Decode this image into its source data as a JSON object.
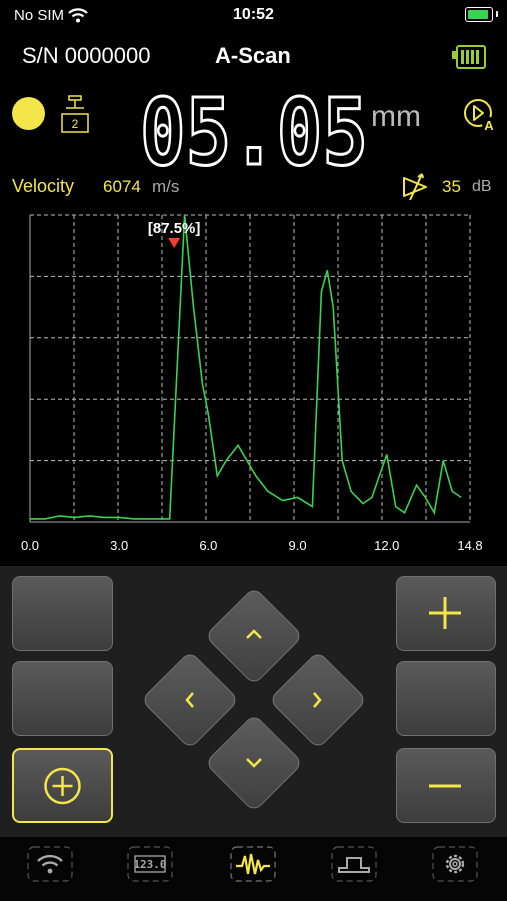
{
  "status": {
    "carrier": "No SIM",
    "time": "10:52"
  },
  "header": {
    "serial": "S/N 0000000",
    "mode": "A-Scan"
  },
  "reading": {
    "value": "05.05",
    "unit": "mm"
  },
  "calibration_badge": "2",
  "velocity": {
    "label": "Velocity",
    "value": "6074",
    "unit": "m/s"
  },
  "gain": {
    "value": "35",
    "unit": "dB"
  },
  "colors": {
    "accent": "#f4e64a",
    "signal": "#39d353",
    "marker": "#ff3b30"
  },
  "chart_data": {
    "type": "line",
    "xlim": [
      0,
      14.8
    ],
    "ylim": [
      0,
      100
    ],
    "grid": true,
    "x_ticks": [
      "0.0",
      "3.0",
      "6.0",
      "9.0",
      "12.0",
      "14.8"
    ],
    "marker_label": "[87.5%]",
    "marker_x": 5.05,
    "series": [
      {
        "x": [
          0,
          0.5,
          1.0,
          1.5,
          2.0,
          2.5,
          3.0,
          3.5,
          4.0,
          4.5,
          4.7,
          5.0,
          5.2,
          5.5,
          5.8,
          6.0,
          6.3,
          6.6,
          7.0,
          7.3,
          7.6,
          8.0,
          8.5,
          9.0,
          9.5,
          9.8,
          10.0,
          10.2,
          10.5,
          10.8,
          11.2,
          11.5,
          12.0,
          12.3,
          12.6,
          13.0,
          13.3,
          13.6,
          13.9,
          14.2,
          14.5
        ],
        "y": [
          1,
          1,
          2,
          1.5,
          2,
          1.5,
          1.5,
          1,
          1,
          1,
          1,
          60,
          100,
          70,
          45,
          35,
          15,
          20,
          25,
          20,
          15,
          10,
          7,
          8,
          5,
          75,
          82,
          70,
          20,
          10,
          6,
          8,
          22,
          5,
          3,
          12,
          8,
          3,
          20,
          10,
          8
        ]
      }
    ]
  },
  "controls": {
    "plus": "+",
    "minus": "−",
    "target": "⊕",
    "up": "^",
    "down": "v",
    "left": "<",
    "right": ">"
  },
  "tabs": [
    {
      "id": "connect",
      "icon": "wifi-icon"
    },
    {
      "id": "digits",
      "icon": "digits-icon",
      "label": "123.0"
    },
    {
      "id": "ascan",
      "icon": "waveform-icon"
    },
    {
      "id": "bscan",
      "icon": "step-icon"
    },
    {
      "id": "settings",
      "icon": "gear-icon"
    }
  ]
}
